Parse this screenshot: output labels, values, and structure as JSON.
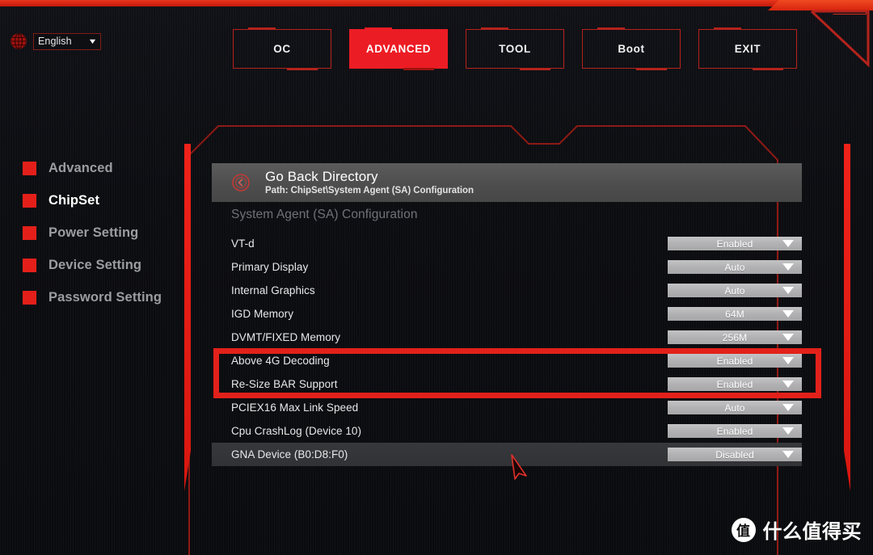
{
  "colors": {
    "accent_red": "#ec1c24",
    "bright_red": "#e2211a",
    "frame_red": "#b5231c",
    "background": "#0c0d11",
    "dropdown_grey": "#b2b2b4",
    "header_grey": "#4e4e4e",
    "sidebar_text": "#9b9da1",
    "active_text": "#ffffff"
  },
  "language_selector": {
    "icon": "globe-icon",
    "value": "English",
    "caret": "▼"
  },
  "nav": {
    "tabs": [
      {
        "label": "OC",
        "active": false
      },
      {
        "label": "ADVANCED",
        "active": true
      },
      {
        "label": "TOOL",
        "active": false
      },
      {
        "label": "Boot",
        "active": false
      },
      {
        "label": "EXIT",
        "active": false
      }
    ]
  },
  "sidebar": {
    "items": [
      {
        "label": "Advanced",
        "active": false
      },
      {
        "label": "ChipSet",
        "active": true
      },
      {
        "label": "Power Setting",
        "active": false
      },
      {
        "label": "Device Setting",
        "active": false
      },
      {
        "label": "Password Setting",
        "active": false
      }
    ]
  },
  "go_back": {
    "icon": "back-arrow-circle-icon",
    "title": "Go Back Directory",
    "path": "Path: ChipSet\\System Agent (SA) Configuration"
  },
  "main": {
    "section_title": "System Agent (SA) Configuration",
    "rows": [
      {
        "label": "VT-d",
        "value": "Enabled",
        "selected": false,
        "highlighted": false
      },
      {
        "label": "Primary Display",
        "value": "Auto",
        "selected": false,
        "highlighted": false
      },
      {
        "label": "Internal Graphics",
        "value": "Auto",
        "selected": false,
        "highlighted": false
      },
      {
        "label": "IGD Memory",
        "value": "64M",
        "selected": false,
        "highlighted": false
      },
      {
        "label": "DVMT/FIXED Memory",
        "value": "256M",
        "selected": false,
        "highlighted": false
      },
      {
        "label": "Above 4G Decoding",
        "value": "Enabled",
        "selected": false,
        "highlighted": true
      },
      {
        "label": "Re-Size BAR Support",
        "value": "Enabled",
        "selected": false,
        "highlighted": true
      },
      {
        "label": "PCIEX16 Max Link Speed",
        "value": "Auto",
        "selected": false,
        "highlighted": false
      },
      {
        "label": "Cpu CrashLog (Device 10)",
        "value": "Enabled",
        "selected": false,
        "highlighted": false
      },
      {
        "label": "GNA Device (B0:D8:F0)",
        "value": "Disabled",
        "selected": true,
        "highlighted": false
      }
    ]
  },
  "cursor": {
    "icon": "mouse-pointer-icon"
  },
  "watermark": {
    "badge": "值",
    "text": "什么值得买"
  }
}
